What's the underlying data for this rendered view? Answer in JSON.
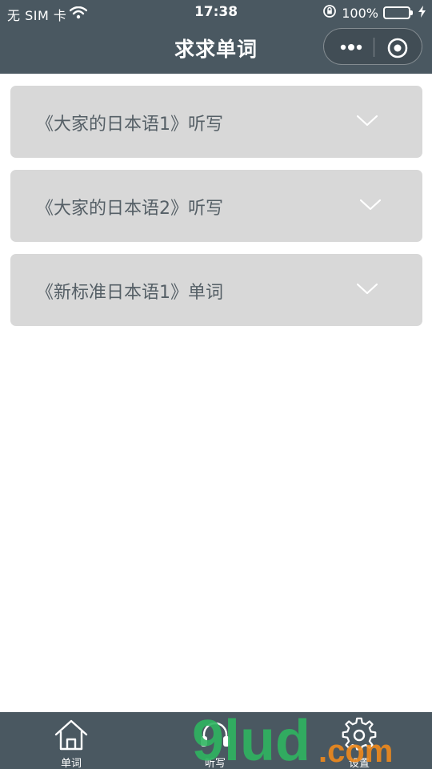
{
  "status_bar": {
    "carrier": "无 SIM 卡",
    "time": "17:38",
    "battery": "100%",
    "icons": [
      "wifi-icon",
      "rotation-lock-icon",
      "battery-icon",
      "charging-icon"
    ]
  },
  "nav": {
    "title": "求求单词",
    "more_icon": "more-dots-icon",
    "close_icon": "capsule-close-icon"
  },
  "sections": [
    {
      "label": "《大家的日本语1》听写",
      "icon": "chevron-down-icon"
    },
    {
      "label": "《大家的日本语2》听写",
      "icon": "chevron-down-icon"
    },
    {
      "label": "《新标准日本语1》单词",
      "icon": "chevron-down-icon"
    }
  ],
  "tabs": [
    {
      "label": "单词",
      "icon": "home-icon"
    },
    {
      "label": "听写",
      "icon": "headset-icon"
    },
    {
      "label": "设置",
      "icon": "gear-icon"
    }
  ],
  "watermark": {
    "text_main": "9lud",
    "text_suffix": ".com"
  },
  "colors": {
    "bar": "#4a5861",
    "card": "#d8d8d8",
    "card_text": "#555f66",
    "battery": "#4cd964",
    "watermark_green": "#2fb560",
    "watermark_orange": "#f08a1c"
  }
}
